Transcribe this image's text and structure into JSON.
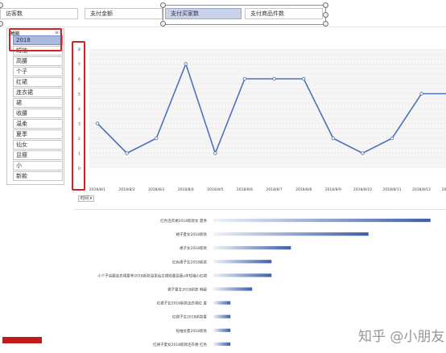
{
  "tabs": [
    {
      "label": "访客数",
      "selected": false
    },
    {
      "label": "支付金额",
      "selected": false
    },
    {
      "label": "支付买家数",
      "selected": true
    },
    {
      "label": "支付商品件数",
      "selected": false
    }
  ],
  "slicer": {
    "header": "时间",
    "header_icons": "≡×",
    "items": [
      {
        "label": "2018",
        "selected": true
      },
      {
        "label": "短袖",
        "selected": false
      },
      {
        "label": "高腰",
        "selected": false
      },
      {
        "label": "个子",
        "selected": false
      },
      {
        "label": "红裙",
        "selected": false
      },
      {
        "label": "连衣裙",
        "selected": false
      },
      {
        "label": "裙",
        "selected": false
      },
      {
        "label": "收腰",
        "selected": false
      },
      {
        "label": "温柔",
        "selected": false
      },
      {
        "label": "夏季",
        "selected": false
      },
      {
        "label": "仙女",
        "selected": false
      },
      {
        "label": "显瘦",
        "selected": false
      },
      {
        "label": "小",
        "selected": false
      },
      {
        "label": "新款",
        "selected": false
      }
    ]
  },
  "chart_filter_label": "时间 ▾",
  "watermark": "知乎 @小朋友",
  "colors": {
    "accent_line": "#4f72b8",
    "highlight_red": "#d22222",
    "selected_tab": "#c9d3ea",
    "selected_item": "#a9b9df"
  },
  "chart_data": [
    {
      "type": "line",
      "title": "",
      "xlabel": "",
      "ylabel": "",
      "categories": [
        "2018/8/1",
        "2018/8/2",
        "2018/8/3",
        "2018/8/4",
        "2018/8/5",
        "2018/8/6",
        "2018/8/7",
        "2018/8/8",
        "2018/8/9",
        "2018/8/10",
        "2018/8/11",
        "2018/8/12",
        "2018/8/13"
      ],
      "values": [
        3,
        1,
        2,
        7,
        1,
        6,
        6,
        6,
        2,
        1,
        2,
        5,
        5
      ],
      "ylim": [
        0,
        8
      ],
      "yticks": [
        0,
        1,
        2,
        3,
        4,
        5,
        6,
        7,
        8
      ],
      "grid": true
    },
    {
      "type": "bar",
      "orientation": "horizontal",
      "title": "",
      "categories": [
        "红色连衣裙2018新款女 夏季",
        "裙子夏女2018新款",
        "裙子女2018新款",
        "红色裙子女2018新款",
        "小个子高腰连衣裙夏季2018新款温柔仙女裙收腰显瘦a字短袖小红裙",
        "裙子夏女2018新款 韩版",
        "红裙子女2018新款连衣裙红 夏",
        "红裙子女2018新款夏",
        "短袖女夏2018新款",
        "红裙子夏女2018新款连衣裙 红色"
      ],
      "values": [
        28,
        20,
        10,
        7.5,
        7.5,
        5,
        2.2,
        2.2,
        2.2,
        2.2
      ],
      "xlim": [
        0,
        30
      ],
      "grid": false
    }
  ]
}
